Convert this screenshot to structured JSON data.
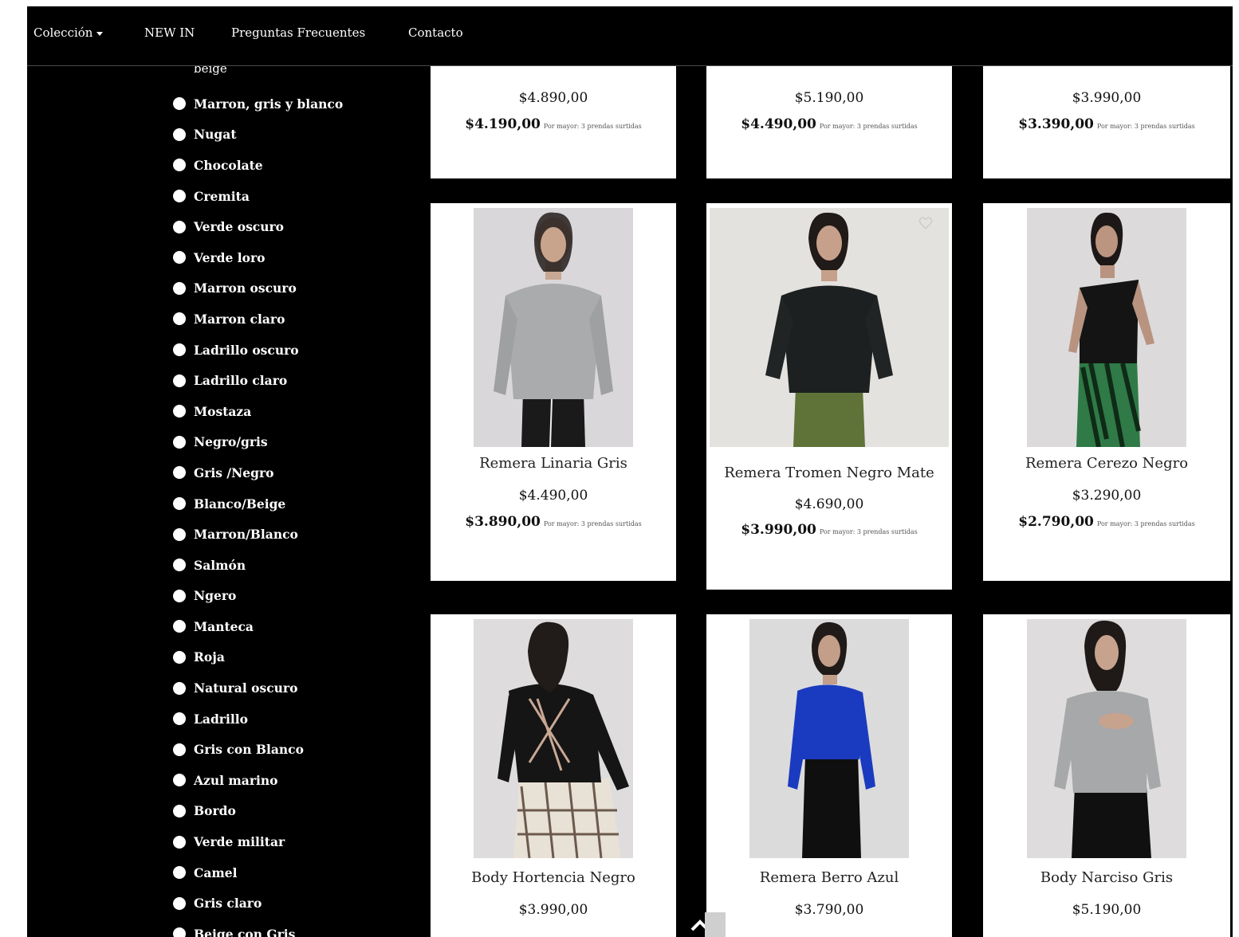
{
  "nav": {
    "items": [
      {
        "label": "Colección",
        "has_dropdown": true
      },
      {
        "label": "NEW IN"
      },
      {
        "label": "Preguntas Frecuentes"
      },
      {
        "label": "Contacto"
      }
    ]
  },
  "sidebar": {
    "partial_top": "beige",
    "colors": [
      "Marron, gris y blanco",
      "Nugat",
      "Chocolate",
      "Cremita",
      "Verde oscuro",
      "Verde loro",
      "Marron oscuro",
      "Marron claro",
      "Ladrillo oscuro",
      "Ladrillo claro",
      "Mostaza",
      "Negro/gris",
      "Gris /Negro",
      "Blanco/Beige",
      "Marron/Blanco",
      "Salmón",
      "Ngero",
      "Manteca",
      "Roja",
      "Natural oscuro",
      "Ladrillo",
      "Gris con Blanco",
      "Azul marino",
      "Bordo",
      "Verde militar",
      "Camel",
      "Gris claro",
      "Beige con Gris"
    ]
  },
  "wholesale_note": "Por mayor: 3 prendas surtidas",
  "products": {
    "row1": [
      {
        "price": "$4.890,00",
        "wholesale": "$4.190,00"
      },
      {
        "price": "$5.190,00",
        "wholesale": "$4.490,00"
      },
      {
        "price": "$3.990,00",
        "wholesale": "$3.390,00"
      }
    ],
    "row2": [
      {
        "name": "Remera Linaria Gris",
        "price": "$4.490,00",
        "wholesale": "$3.890,00"
      },
      {
        "name": "Remera Tromen Negro Mate",
        "price": "$4.690,00",
        "wholesale": "$3.990,00"
      },
      {
        "name": "Remera Cerezo Negro",
        "price": "$3.290,00",
        "wholesale": "$2.790,00"
      }
    ],
    "row3": [
      {
        "name": "Body Hortencia Negro",
        "price": "$3.990,00"
      },
      {
        "name": "Remera Berro Azul",
        "price": "$3.790,00"
      },
      {
        "name": "Body Narciso Gris",
        "price": "$5.190,00"
      }
    ]
  },
  "icons": {
    "scroll_top": "chevron-up-icon",
    "favorite": "heart-icon"
  },
  "colors": {
    "background": "#000000",
    "card": "#ffffff",
    "text_light": "#ffffff",
    "text_dark": "#111111"
  }
}
